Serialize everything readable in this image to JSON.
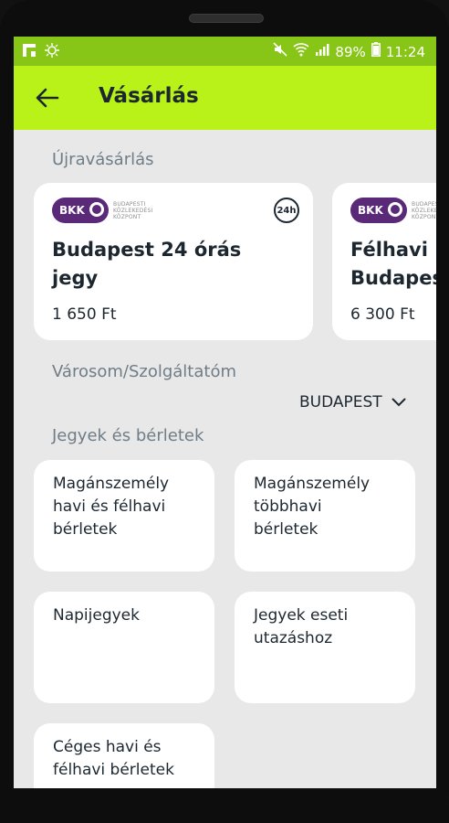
{
  "status_bar": {
    "left_icons": [
      "flipboard-icon",
      "brightness-icon"
    ],
    "battery": "89%",
    "time": "11:24"
  },
  "app_bar": {
    "title": "Vásárlás"
  },
  "rebuy": {
    "section_label": "Újravásárlás",
    "cards": [
      {
        "provider_short": "BKK",
        "provider_full": "BUDAPESTI\nKÖZLEKEDÉSI\nKÖZPONT",
        "badge": "24h",
        "title": "Budapest 24 órás\njegy",
        "price": "1 650 Ft"
      },
      {
        "provider_short": "BKK",
        "provider_full": "BUDAPESTI\nKÖZLEKEDÉSI\nKÖZPONT",
        "title": "Félhavi\nBudapest",
        "price": "6 300 Ft"
      }
    ]
  },
  "city_section": {
    "label": "Városom/Szolgáltatóm",
    "selected": "BUDAPEST"
  },
  "tickets": {
    "section_label": "Jegyek és bérletek",
    "tiles": [
      "Magánszemély\nhavi és félhavi\nbérletek",
      "Magánszemély\ntöbbhavi\nbérletek",
      "Napijegyek",
      "Jegyek eseti\nutazáshoz",
      "Céges havi és\nfélhavi bérletek"
    ]
  },
  "colors": {
    "app_bar": "#b9f218",
    "status_bar": "#87c516",
    "bkk_purple": "#5a2a78",
    "background": "#e8e8e8"
  }
}
